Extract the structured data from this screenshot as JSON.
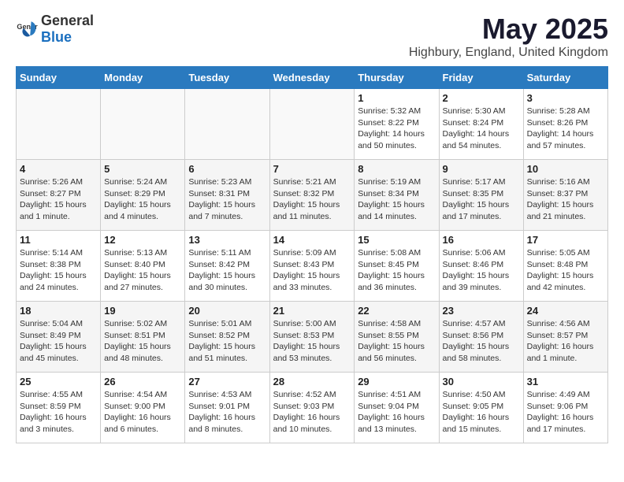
{
  "header": {
    "logo_general": "General",
    "logo_blue": "Blue",
    "month": "May 2025",
    "location": "Highbury, England, United Kingdom"
  },
  "weekdays": [
    "Sunday",
    "Monday",
    "Tuesday",
    "Wednesday",
    "Thursday",
    "Friday",
    "Saturday"
  ],
  "weeks": [
    [
      {
        "day": "",
        "info": ""
      },
      {
        "day": "",
        "info": ""
      },
      {
        "day": "",
        "info": ""
      },
      {
        "day": "",
        "info": ""
      },
      {
        "day": "1",
        "info": "Sunrise: 5:32 AM\nSunset: 8:22 PM\nDaylight: 14 hours\nand 50 minutes."
      },
      {
        "day": "2",
        "info": "Sunrise: 5:30 AM\nSunset: 8:24 PM\nDaylight: 14 hours\nand 54 minutes."
      },
      {
        "day": "3",
        "info": "Sunrise: 5:28 AM\nSunset: 8:26 PM\nDaylight: 14 hours\nand 57 minutes."
      }
    ],
    [
      {
        "day": "4",
        "info": "Sunrise: 5:26 AM\nSunset: 8:27 PM\nDaylight: 15 hours\nand 1 minute."
      },
      {
        "day": "5",
        "info": "Sunrise: 5:24 AM\nSunset: 8:29 PM\nDaylight: 15 hours\nand 4 minutes."
      },
      {
        "day": "6",
        "info": "Sunrise: 5:23 AM\nSunset: 8:31 PM\nDaylight: 15 hours\nand 7 minutes."
      },
      {
        "day": "7",
        "info": "Sunrise: 5:21 AM\nSunset: 8:32 PM\nDaylight: 15 hours\nand 11 minutes."
      },
      {
        "day": "8",
        "info": "Sunrise: 5:19 AM\nSunset: 8:34 PM\nDaylight: 15 hours\nand 14 minutes."
      },
      {
        "day": "9",
        "info": "Sunrise: 5:17 AM\nSunset: 8:35 PM\nDaylight: 15 hours\nand 17 minutes."
      },
      {
        "day": "10",
        "info": "Sunrise: 5:16 AM\nSunset: 8:37 PM\nDaylight: 15 hours\nand 21 minutes."
      }
    ],
    [
      {
        "day": "11",
        "info": "Sunrise: 5:14 AM\nSunset: 8:38 PM\nDaylight: 15 hours\nand 24 minutes."
      },
      {
        "day": "12",
        "info": "Sunrise: 5:13 AM\nSunset: 8:40 PM\nDaylight: 15 hours\nand 27 minutes."
      },
      {
        "day": "13",
        "info": "Sunrise: 5:11 AM\nSunset: 8:42 PM\nDaylight: 15 hours\nand 30 minutes."
      },
      {
        "day": "14",
        "info": "Sunrise: 5:09 AM\nSunset: 8:43 PM\nDaylight: 15 hours\nand 33 minutes."
      },
      {
        "day": "15",
        "info": "Sunrise: 5:08 AM\nSunset: 8:45 PM\nDaylight: 15 hours\nand 36 minutes."
      },
      {
        "day": "16",
        "info": "Sunrise: 5:06 AM\nSunset: 8:46 PM\nDaylight: 15 hours\nand 39 minutes."
      },
      {
        "day": "17",
        "info": "Sunrise: 5:05 AM\nSunset: 8:48 PM\nDaylight: 15 hours\nand 42 minutes."
      }
    ],
    [
      {
        "day": "18",
        "info": "Sunrise: 5:04 AM\nSunset: 8:49 PM\nDaylight: 15 hours\nand 45 minutes."
      },
      {
        "day": "19",
        "info": "Sunrise: 5:02 AM\nSunset: 8:51 PM\nDaylight: 15 hours\nand 48 minutes."
      },
      {
        "day": "20",
        "info": "Sunrise: 5:01 AM\nSunset: 8:52 PM\nDaylight: 15 hours\nand 51 minutes."
      },
      {
        "day": "21",
        "info": "Sunrise: 5:00 AM\nSunset: 8:53 PM\nDaylight: 15 hours\nand 53 minutes."
      },
      {
        "day": "22",
        "info": "Sunrise: 4:58 AM\nSunset: 8:55 PM\nDaylight: 15 hours\nand 56 minutes."
      },
      {
        "day": "23",
        "info": "Sunrise: 4:57 AM\nSunset: 8:56 PM\nDaylight: 15 hours\nand 58 minutes."
      },
      {
        "day": "24",
        "info": "Sunrise: 4:56 AM\nSunset: 8:57 PM\nDaylight: 16 hours\nand 1 minute."
      }
    ],
    [
      {
        "day": "25",
        "info": "Sunrise: 4:55 AM\nSunset: 8:59 PM\nDaylight: 16 hours\nand 3 minutes."
      },
      {
        "day": "26",
        "info": "Sunrise: 4:54 AM\nSunset: 9:00 PM\nDaylight: 16 hours\nand 6 minutes."
      },
      {
        "day": "27",
        "info": "Sunrise: 4:53 AM\nSunset: 9:01 PM\nDaylight: 16 hours\nand 8 minutes."
      },
      {
        "day": "28",
        "info": "Sunrise: 4:52 AM\nSunset: 9:03 PM\nDaylight: 16 hours\nand 10 minutes."
      },
      {
        "day": "29",
        "info": "Sunrise: 4:51 AM\nSunset: 9:04 PM\nDaylight: 16 hours\nand 13 minutes."
      },
      {
        "day": "30",
        "info": "Sunrise: 4:50 AM\nSunset: 9:05 PM\nDaylight: 16 hours\nand 15 minutes."
      },
      {
        "day": "31",
        "info": "Sunrise: 4:49 AM\nSunset: 9:06 PM\nDaylight: 16 hours\nand 17 minutes."
      }
    ]
  ]
}
